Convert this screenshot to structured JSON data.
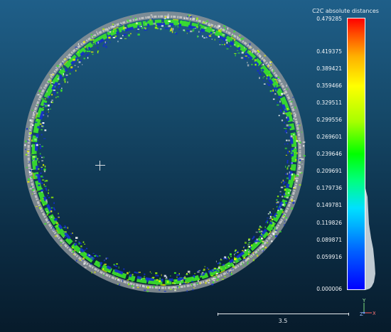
{
  "viewer": {
    "scalar_field_title": "C2C absolute distances",
    "colorbar_ticks": [
      "0.479285",
      "0.419375",
      "0.389421",
      "0.359466",
      "0.329511",
      "0.299556",
      "0.269601",
      "0.239646",
      "0.209691",
      "0.179736",
      "0.149781",
      "0.119826",
      "0.089871",
      "0.059916",
      "0.000006"
    ],
    "colorbar_range": [
      6e-06,
      0.479285
    ],
    "scale_bar_label": "3.5",
    "axes": {
      "x": "X",
      "y": "Y",
      "z": "Z"
    },
    "colors": {
      "background_top": "#1f5f89",
      "background_bottom": "#071b2b",
      "ring_blue": "#1530c8",
      "ring_green": "#3be62a",
      "ring_gray": "#c8c8c8",
      "ring_yellow": "#e6ee00"
    },
    "icons": [
      "crosshair-icon",
      "axis-trihedron-icon"
    ]
  }
}
